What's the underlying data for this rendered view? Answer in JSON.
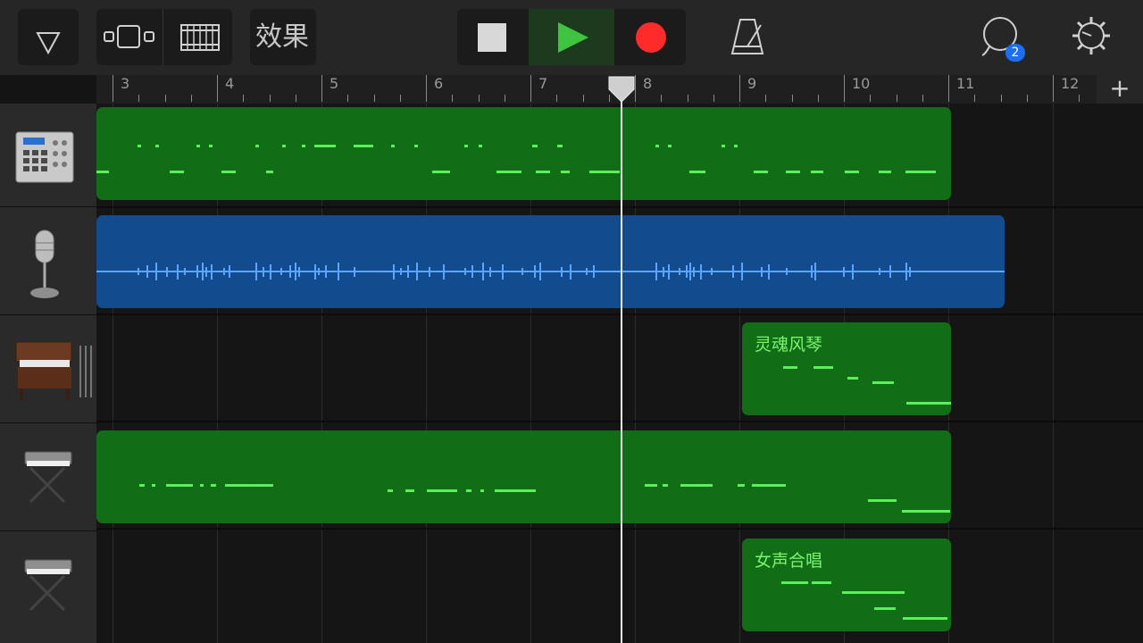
{
  "toolbar": {
    "effects_label": "效果",
    "notification_count": "2",
    "play_color": "#3ec43e",
    "record_color": "#ff2a2a"
  },
  "ruler": {
    "bars": [
      "3",
      "4",
      "5",
      "6",
      "7",
      "8",
      "9",
      "10",
      "11",
      "12"
    ],
    "add_label": "+"
  },
  "tracks": [
    {
      "instrument": "drum-machine-icon"
    },
    {
      "instrument": "microphone-icon"
    },
    {
      "instrument": "organ-icon"
    },
    {
      "instrument": "synth-keyboard-icon"
    },
    {
      "instrument": "synth-keyboard-icon"
    }
  ],
  "regions": {
    "organ_region_name": "灵魂风琴",
    "choir_region_name": "女声合唱"
  },
  "colors": {
    "midi_region": "#116e17",
    "audio_region": "#134c8e",
    "note": "#5af05a",
    "waveform": "#5aa6ff"
  }
}
